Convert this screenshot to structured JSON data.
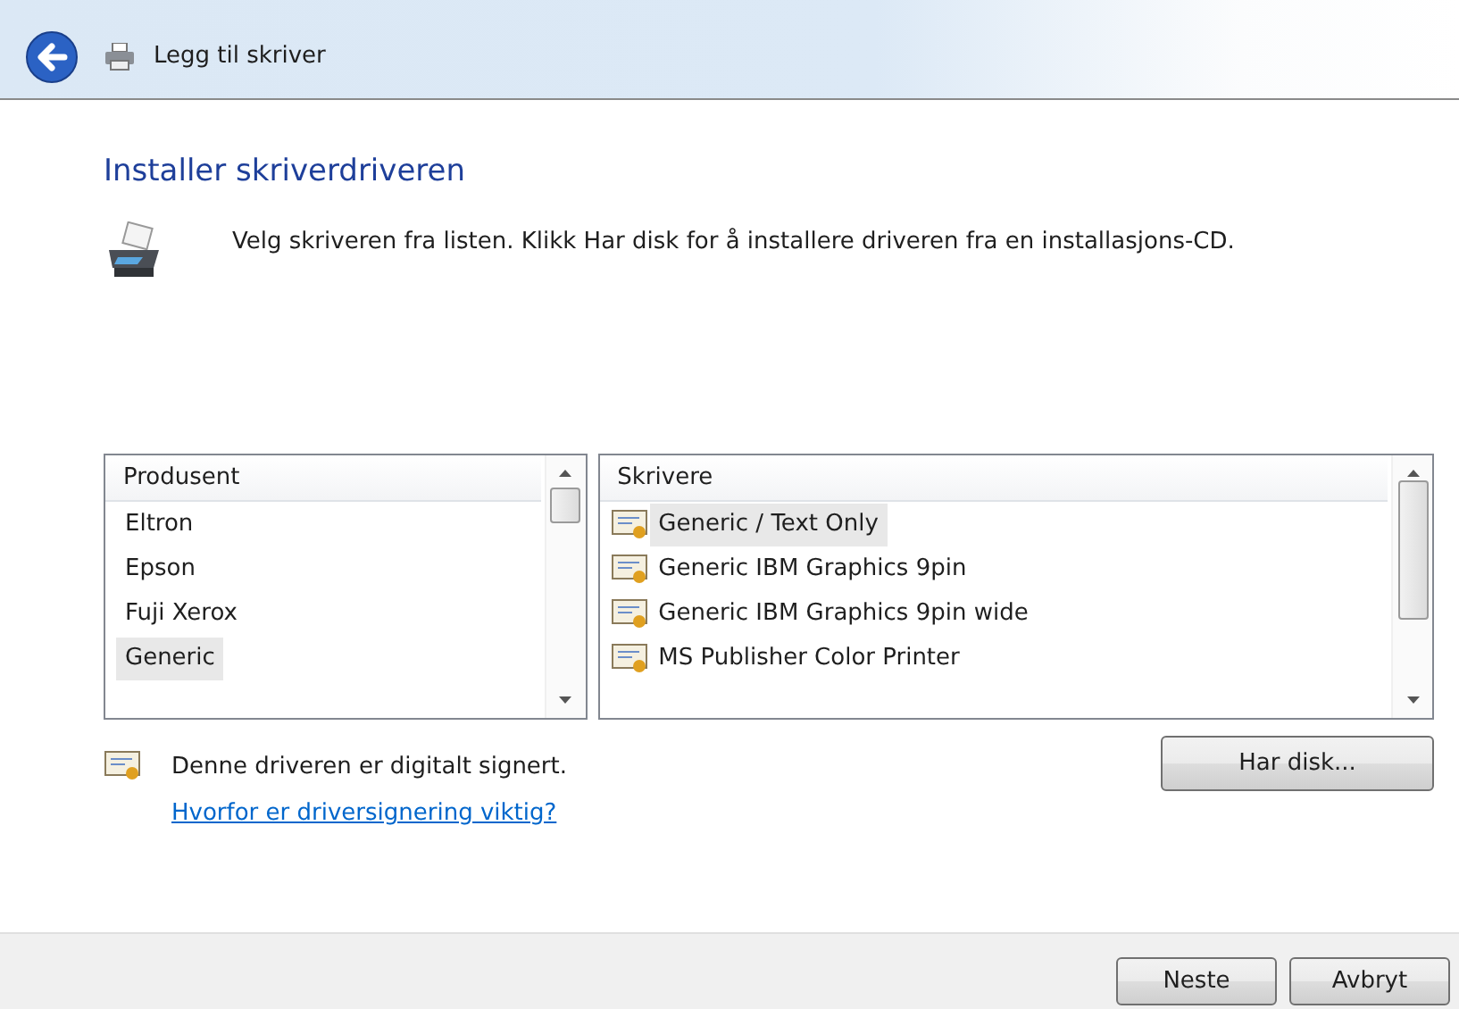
{
  "header": {
    "title": "Legg til skriver"
  },
  "heading": "Installer skriverdriveren",
  "instruction": "Velg skriveren fra listen. Klikk Har disk for å installere driveren fra en installasjons-CD.",
  "manufacturers": {
    "column": "Produsent",
    "items": [
      {
        "label": "Eltron",
        "selected": false
      },
      {
        "label": "Epson",
        "selected": false
      },
      {
        "label": "Fuji Xerox",
        "selected": false
      },
      {
        "label": "Generic",
        "selected": true
      }
    ]
  },
  "printers": {
    "column": "Skrivere",
    "items": [
      {
        "label": "Generic / Text Only",
        "selected": true
      },
      {
        "label": "Generic IBM Graphics 9pin",
        "selected": false
      },
      {
        "label": "Generic IBM Graphics 9pin wide",
        "selected": false
      },
      {
        "label": "MS Publisher Color Printer",
        "selected": false
      }
    ]
  },
  "signed_note": "Denne driveren er digitalt signert.",
  "signing_link": "Hvorfor er driversignering viktig?",
  "have_disk_button": "Har disk...",
  "footer_buttons": [
    "Neste",
    "Avbryt"
  ]
}
